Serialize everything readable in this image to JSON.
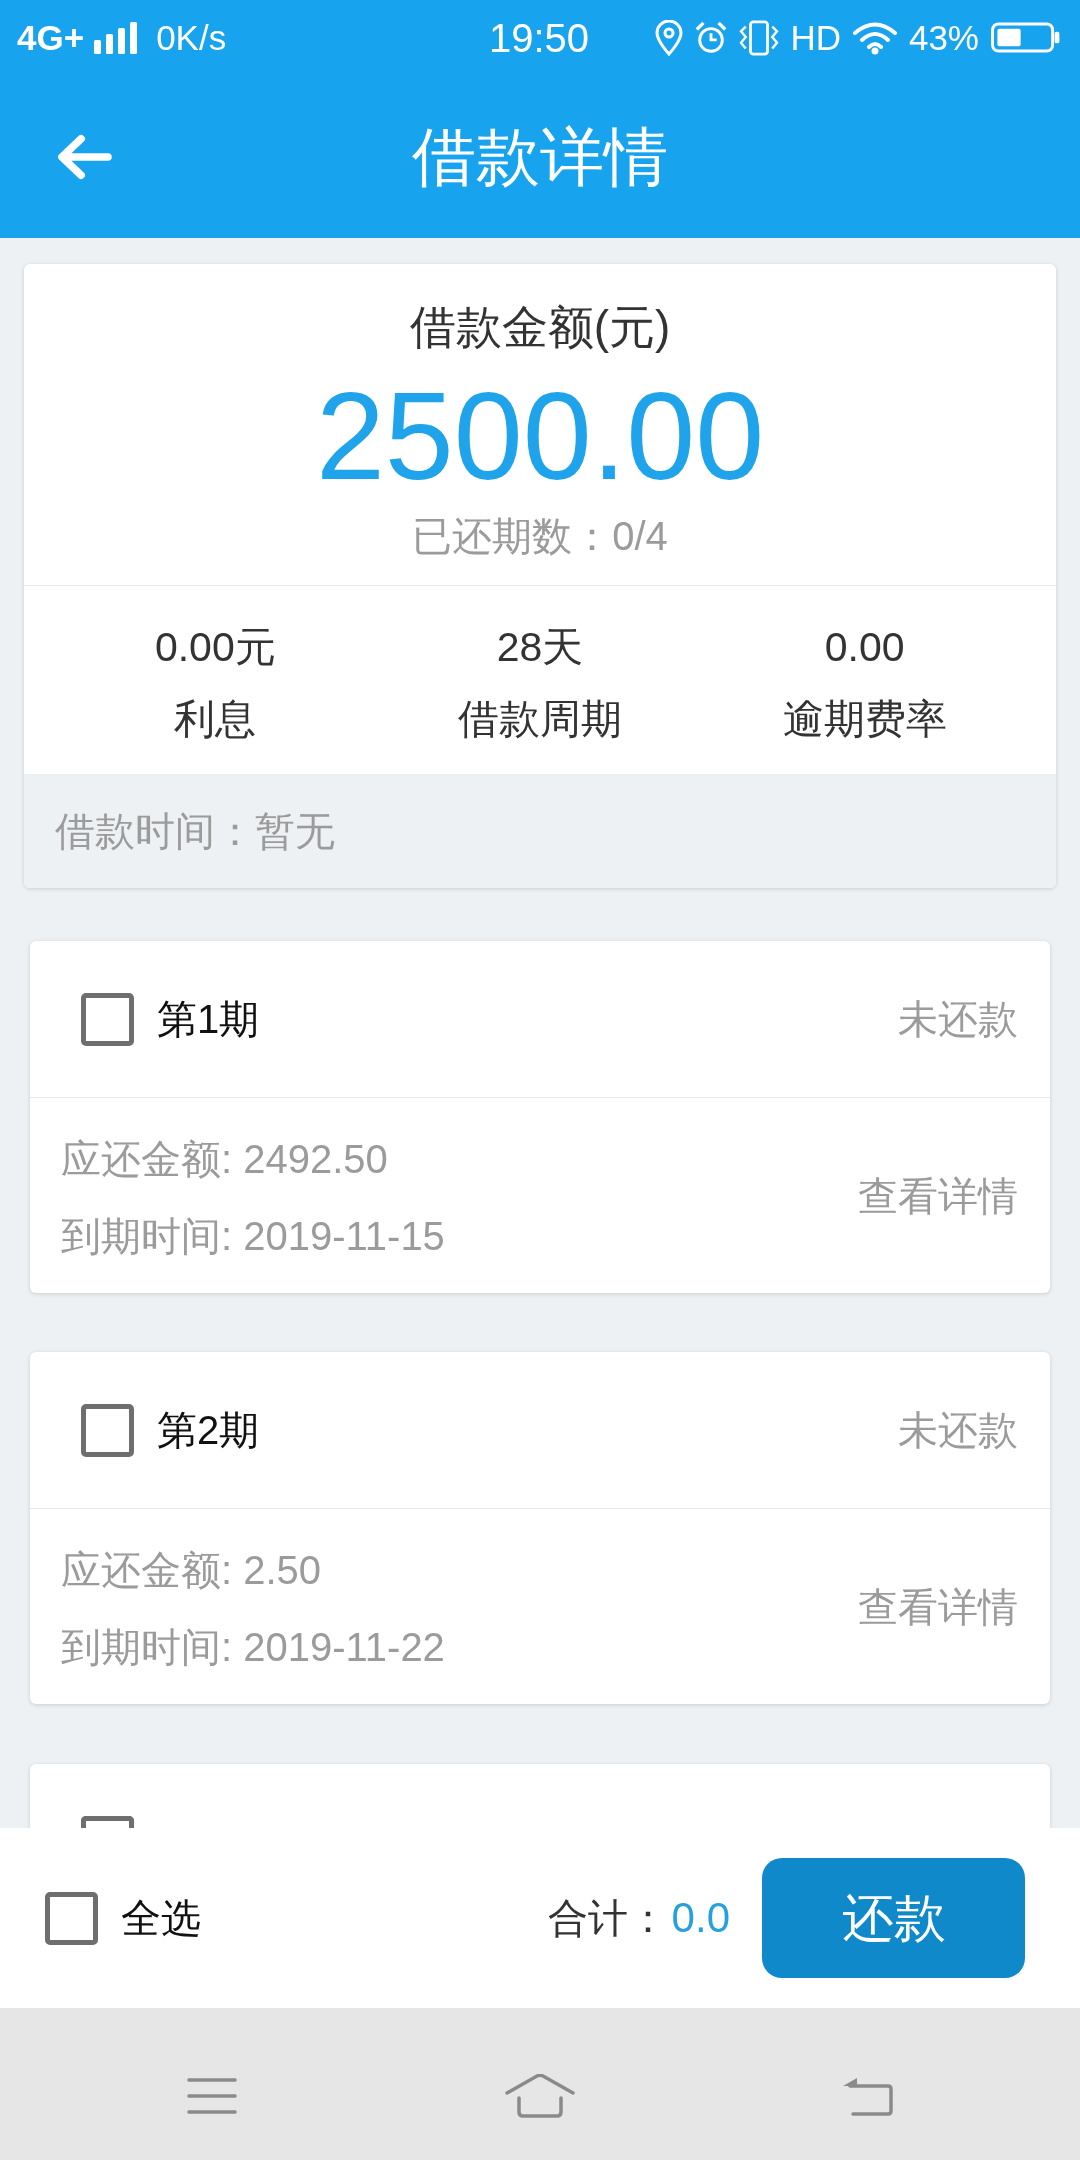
{
  "status_bar": {
    "network": "4G+",
    "speed": "0K/s",
    "time": "19:50",
    "hd": "HD",
    "battery": "43%"
  },
  "header": {
    "title": "借款详情"
  },
  "summary": {
    "amount_label": "借款金额(元)",
    "amount": "2500.00",
    "paid_periods": "已还期数：0/4",
    "stats": [
      {
        "value": "0.00元",
        "label": "利息"
      },
      {
        "value": "28天",
        "label": "借款周期"
      },
      {
        "value": "0.00",
        "label": "逾期费率"
      }
    ],
    "loan_time": "借款时间：暂无"
  },
  "periods": [
    {
      "kind": "full",
      "title": "第1期",
      "checked": false,
      "status": "未还款",
      "amount": "应还金额: 2492.50",
      "due": "到期时间: 2019-11-15",
      "link": "查看详情"
    },
    {
      "kind": "full",
      "title": "第2期",
      "checked": false,
      "status": "未还款",
      "amount": "应还金额: 2.50",
      "due": "到期时间: 2019-11-22",
      "link": "查看详情"
    },
    {
      "kind": "peek",
      "checked": false
    }
  ],
  "footer": {
    "select_all": {
      "label": "全选",
      "checked": false
    },
    "total_label": "合计：",
    "total": "0.0",
    "pay_button": "还款"
  }
}
